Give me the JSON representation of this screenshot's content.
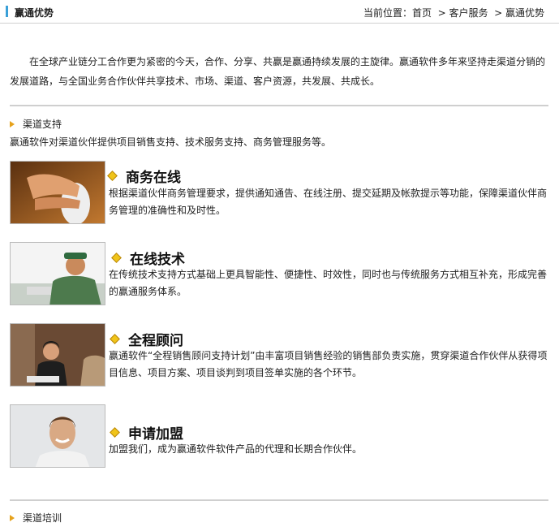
{
  "header": {
    "title": "赢通优势",
    "breadcrumb_prefix": "当前位置：",
    "breadcrumb": [
      "首页",
      "> 客户服务",
      "> 赢通优势"
    ]
  },
  "intro": "在全球产业链分工合作更为紧密的今天，合作、分享、共赢是赢通持续发展的主旋律。赢通软件多年来坚持走渠道分销的发展道路，与全国业务合作伙伴共享技术、市场、渠道、客户资源，共发展、共成长。",
  "channel_support": {
    "heading": "渠道支持",
    "description": "赢通软件对渠道伙伴提供项目销售支持、技术服务支持、商务管理服务等。",
    "items": [
      {
        "title": "商务在线",
        "text": "根据渠道伙伴商务管理要求，提供通知通告、在线注册、提交延期及帐款提示等功能，保障渠道伙伴商务管理的准确性和及时性。"
      },
      {
        "title": "在线技术",
        "text": "在传统技术支持方式基础上更具智能性、便捷性、时效性，同时也与传统服务方式相互补充，形成完善的赢通服务体系。"
      },
      {
        "title": "全程顾问",
        "text": "赢通软件“全程销售顾问支持计划”由丰富项目销售经验的销售部负责实施，贯穿渠道合作伙伴从获得项目信息、项目方案、项目谈判到项目签单实施的各个环节。"
      },
      {
        "title": "申请加盟",
        "text": "加盟我们，成为赢通软件软件产品的代理和长期合作伙伴。"
      }
    ]
  },
  "channel_training": {
    "heading": "渠道培训"
  },
  "colors": {
    "accent_bar": "#3aa0d8",
    "triangle": "#e6a21c",
    "diamond": "#f0c419",
    "divider": "#cfcfcf"
  }
}
